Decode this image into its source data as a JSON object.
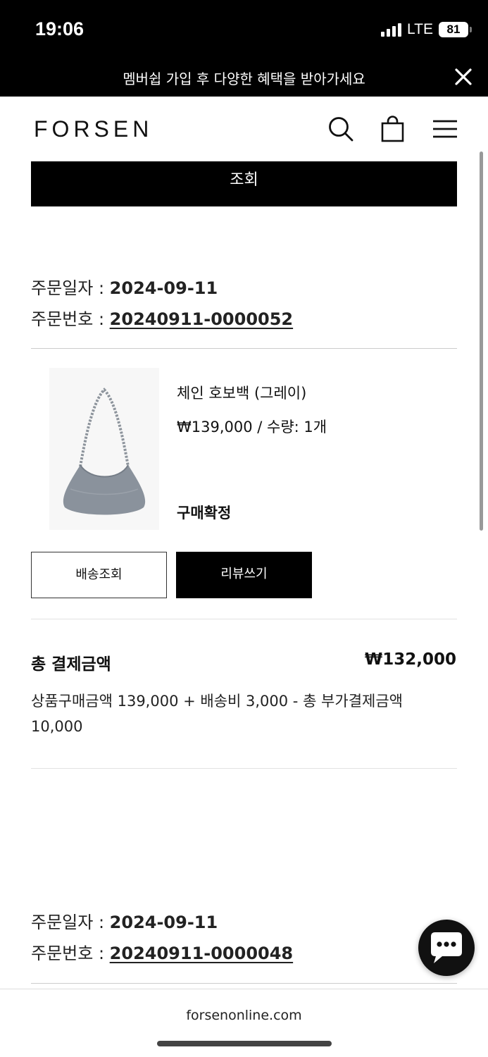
{
  "status_bar": {
    "time": "19:06",
    "network": "LTE",
    "battery": "81"
  },
  "banner": {
    "text": "멤버쉽 가입 후 다양한 혜택을 받아가세요",
    "close_icon": "close-icon"
  },
  "header": {
    "logo": "FORSEN",
    "icons": [
      "search-icon",
      "shopping-bag-icon",
      "menu-icon"
    ]
  },
  "search_button": {
    "label": "조회"
  },
  "orders": [
    {
      "date_label": "주문일자 : ",
      "date": "2024-09-11",
      "number_label": "주문번호 : ",
      "number": "20240911-0000052",
      "item": {
        "name": "체인 호보백 (그레이)",
        "price_qty": "₩139,000 / 수량: 1개",
        "status": "구매확정",
        "image_icon": "gray-hobo-bag-image"
      },
      "actions": {
        "track": "배송조회",
        "review": "리뷰쓰기"
      },
      "total": {
        "label": "총 결제금액",
        "value": "₩132,000",
        "breakdown": "상품구매금액 139,000 + 배송비 3,000 - 총 부가결제금액 10,000"
      }
    },
    {
      "date_label": "주문일자 : ",
      "date": "2024-09-11",
      "number_label": "주문번호 : ",
      "number": "20240911-0000048"
    }
  ],
  "chat": {
    "icon": "chat-bubble-icon"
  },
  "browser": {
    "url": "forsenonline.com"
  },
  "colors": {
    "primary": "#000000",
    "divider": "#cccccc",
    "product_gray": "#8a929c"
  }
}
